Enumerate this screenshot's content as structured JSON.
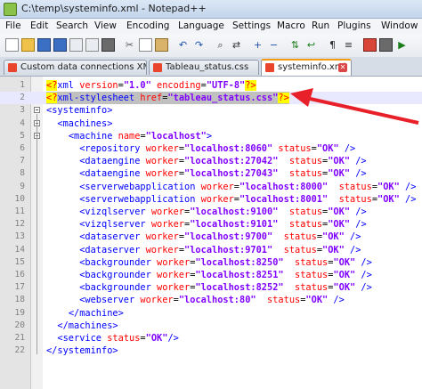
{
  "window": {
    "title": "C:\\temp\\systeminfo.xml - Notepad++"
  },
  "menu": [
    "File",
    "Edit",
    "Search",
    "View",
    "Encoding",
    "Language",
    "Settings",
    "Macro",
    "Run",
    "Plugins",
    "Window"
  ],
  "tabs": [
    {
      "label": "Custom data connections XML.txt",
      "active": false
    },
    {
      "label": "Tableau_status.css",
      "active": false
    },
    {
      "label": "systeminfo.xml",
      "active": true
    }
  ],
  "colors": {
    "accent_arrow": "#e8202a",
    "tag": "#0000ff",
    "attr": "#ff0000",
    "value": "#8000ff"
  },
  "lines": [
    {
      "n": "1",
      "indent": "",
      "parts": [
        [
          "pi",
          "<?"
        ],
        [
          "tag",
          "xml"
        ],
        [
          "txt",
          " "
        ],
        [
          "attr",
          "version"
        ],
        [
          "txt",
          "="
        ],
        [
          "val",
          "\"1.0\""
        ],
        [
          "txt",
          " "
        ],
        [
          "attr",
          "encoding"
        ],
        [
          "txt",
          "="
        ],
        [
          "val",
          "\"UTF-8\""
        ],
        [
          "pi",
          "?>"
        ]
      ]
    },
    {
      "n": "2",
      "indent": "",
      "parts": [
        [
          "pi",
          "<?"
        ],
        [
          "tag",
          "xml-stylesheet"
        ],
        [
          "txt",
          " "
        ],
        [
          "attr",
          "href"
        ],
        [
          "txt",
          "="
        ],
        [
          "val",
          "\"tableau_status.css\""
        ],
        [
          "pi",
          "?>"
        ]
      ]
    },
    {
      "n": "3",
      "indent": "",
      "parts": [
        [
          "tag",
          "<systeminfo>"
        ]
      ]
    },
    {
      "n": "4",
      "indent": "  ",
      "parts": [
        [
          "tag",
          "<machines>"
        ]
      ]
    },
    {
      "n": "5",
      "indent": "    ",
      "parts": [
        [
          "tag",
          "<machine"
        ],
        [
          "txt",
          " "
        ],
        [
          "attr",
          "name"
        ],
        [
          "txt",
          "="
        ],
        [
          "val",
          "\"localhost\""
        ],
        [
          "tag",
          ">"
        ]
      ]
    },
    {
      "n": "6",
      "indent": "      ",
      "parts": [
        [
          "tag",
          "<repository"
        ],
        [
          "txt",
          " "
        ],
        [
          "attr",
          "worker"
        ],
        [
          "txt",
          "="
        ],
        [
          "val",
          "\"localhost:8060\""
        ],
        [
          "txt",
          " "
        ],
        [
          "attr",
          "status"
        ],
        [
          "txt",
          "="
        ],
        [
          "val",
          "\"OK\""
        ],
        [
          "tag",
          " />"
        ]
      ]
    },
    {
      "n": "7",
      "indent": "      ",
      "parts": [
        [
          "tag",
          "<dataengine"
        ],
        [
          "txt",
          " "
        ],
        [
          "attr",
          "worker"
        ],
        [
          "txt",
          "="
        ],
        [
          "val",
          "\"localhost:27042\""
        ],
        [
          "txt",
          "  "
        ],
        [
          "attr",
          "status"
        ],
        [
          "txt",
          "="
        ],
        [
          "val",
          "\"OK\""
        ],
        [
          "tag",
          " />"
        ]
      ]
    },
    {
      "n": "8",
      "indent": "      ",
      "parts": [
        [
          "tag",
          "<dataengine"
        ],
        [
          "txt",
          " "
        ],
        [
          "attr",
          "worker"
        ],
        [
          "txt",
          "="
        ],
        [
          "val",
          "\"localhost:27043\""
        ],
        [
          "txt",
          "  "
        ],
        [
          "attr",
          "status"
        ],
        [
          "txt",
          "="
        ],
        [
          "val",
          "\"OK\""
        ],
        [
          "tag",
          " />"
        ]
      ]
    },
    {
      "n": "9",
      "indent": "      ",
      "parts": [
        [
          "tag",
          "<serverwebapplication"
        ],
        [
          "txt",
          " "
        ],
        [
          "attr",
          "worker"
        ],
        [
          "txt",
          "="
        ],
        [
          "val",
          "\"localhost:8000\""
        ],
        [
          "txt",
          "  "
        ],
        [
          "attr",
          "status"
        ],
        [
          "txt",
          "="
        ],
        [
          "val",
          "\"OK\""
        ],
        [
          "tag",
          " />"
        ]
      ]
    },
    {
      "n": "10",
      "indent": "      ",
      "parts": [
        [
          "tag",
          "<serverwebapplication"
        ],
        [
          "txt",
          " "
        ],
        [
          "attr",
          "worker"
        ],
        [
          "txt",
          "="
        ],
        [
          "val",
          "\"localhost:8001\""
        ],
        [
          "txt",
          "  "
        ],
        [
          "attr",
          "status"
        ],
        [
          "txt",
          "="
        ],
        [
          "val",
          "\"OK\""
        ],
        [
          "tag",
          " />"
        ]
      ]
    },
    {
      "n": "11",
      "indent": "      ",
      "parts": [
        [
          "tag",
          "<vizqlserver"
        ],
        [
          "txt",
          " "
        ],
        [
          "attr",
          "worker"
        ],
        [
          "txt",
          "="
        ],
        [
          "val",
          "\"localhost:9100\""
        ],
        [
          "txt",
          "  "
        ],
        [
          "attr",
          "status"
        ],
        [
          "txt",
          "="
        ],
        [
          "val",
          "\"OK\""
        ],
        [
          "tag",
          " />"
        ]
      ]
    },
    {
      "n": "12",
      "indent": "      ",
      "parts": [
        [
          "tag",
          "<vizqlserver"
        ],
        [
          "txt",
          " "
        ],
        [
          "attr",
          "worker"
        ],
        [
          "txt",
          "="
        ],
        [
          "val",
          "\"localhost:9101\""
        ],
        [
          "txt",
          "  "
        ],
        [
          "attr",
          "status"
        ],
        [
          "txt",
          "="
        ],
        [
          "val",
          "\"OK\""
        ],
        [
          "tag",
          " />"
        ]
      ]
    },
    {
      "n": "13",
      "indent": "      ",
      "parts": [
        [
          "tag",
          "<dataserver"
        ],
        [
          "txt",
          " "
        ],
        [
          "attr",
          "worker"
        ],
        [
          "txt",
          "="
        ],
        [
          "val",
          "\"localhost:9700\""
        ],
        [
          "txt",
          "  "
        ],
        [
          "attr",
          "status"
        ],
        [
          "txt",
          "="
        ],
        [
          "val",
          "\"OK\""
        ],
        [
          "tag",
          " />"
        ]
      ]
    },
    {
      "n": "14",
      "indent": "      ",
      "parts": [
        [
          "tag",
          "<dataserver"
        ],
        [
          "txt",
          " "
        ],
        [
          "attr",
          "worker"
        ],
        [
          "txt",
          "="
        ],
        [
          "val",
          "\"localhost:9701\""
        ],
        [
          "txt",
          "  "
        ],
        [
          "attr",
          "status"
        ],
        [
          "txt",
          "="
        ],
        [
          "val",
          "\"OK\""
        ],
        [
          "tag",
          " />"
        ]
      ]
    },
    {
      "n": "15",
      "indent": "      ",
      "parts": [
        [
          "tag",
          "<backgrounder"
        ],
        [
          "txt",
          " "
        ],
        [
          "attr",
          "worker"
        ],
        [
          "txt",
          "="
        ],
        [
          "val",
          "\"localhost:8250\""
        ],
        [
          "txt",
          "  "
        ],
        [
          "attr",
          "status"
        ],
        [
          "txt",
          "="
        ],
        [
          "val",
          "\"OK\""
        ],
        [
          "tag",
          " />"
        ]
      ]
    },
    {
      "n": "16",
      "indent": "      ",
      "parts": [
        [
          "tag",
          "<backgrounder"
        ],
        [
          "txt",
          " "
        ],
        [
          "attr",
          "worker"
        ],
        [
          "txt",
          "="
        ],
        [
          "val",
          "\"localhost:8251\""
        ],
        [
          "txt",
          "  "
        ],
        [
          "attr",
          "status"
        ],
        [
          "txt",
          "="
        ],
        [
          "val",
          "\"OK\""
        ],
        [
          "tag",
          " />"
        ]
      ]
    },
    {
      "n": "17",
      "indent": "      ",
      "parts": [
        [
          "tag",
          "<backgrounder"
        ],
        [
          "txt",
          " "
        ],
        [
          "attr",
          "worker"
        ],
        [
          "txt",
          "="
        ],
        [
          "val",
          "\"localhost:8252\""
        ],
        [
          "txt",
          "  "
        ],
        [
          "attr",
          "status"
        ],
        [
          "txt",
          "="
        ],
        [
          "val",
          "\"OK\""
        ],
        [
          "tag",
          " />"
        ]
      ]
    },
    {
      "n": "18",
      "indent": "      ",
      "parts": [
        [
          "tag",
          "<webserver"
        ],
        [
          "txt",
          " "
        ],
        [
          "attr",
          "worker"
        ],
        [
          "txt",
          "="
        ],
        [
          "val",
          "\"localhost:80\""
        ],
        [
          "txt",
          "  "
        ],
        [
          "attr",
          "status"
        ],
        [
          "txt",
          "="
        ],
        [
          "val",
          "\"OK\""
        ],
        [
          "tag",
          " />"
        ]
      ]
    },
    {
      "n": "19",
      "indent": "    ",
      "parts": [
        [
          "tag",
          "</machine>"
        ]
      ]
    },
    {
      "n": "20",
      "indent": "  ",
      "parts": [
        [
          "tag",
          "</machines>"
        ]
      ]
    },
    {
      "n": "21",
      "indent": "  ",
      "parts": [
        [
          "tag",
          "<service"
        ],
        [
          "txt",
          " "
        ],
        [
          "attr",
          "status"
        ],
        [
          "txt",
          "="
        ],
        [
          "val",
          "\"OK\""
        ],
        [
          "tag",
          "/>"
        ]
      ]
    },
    {
      "n": "22",
      "indent": "",
      "parts": [
        [
          "tag",
          "</systeminfo>"
        ]
      ]
    }
  ]
}
